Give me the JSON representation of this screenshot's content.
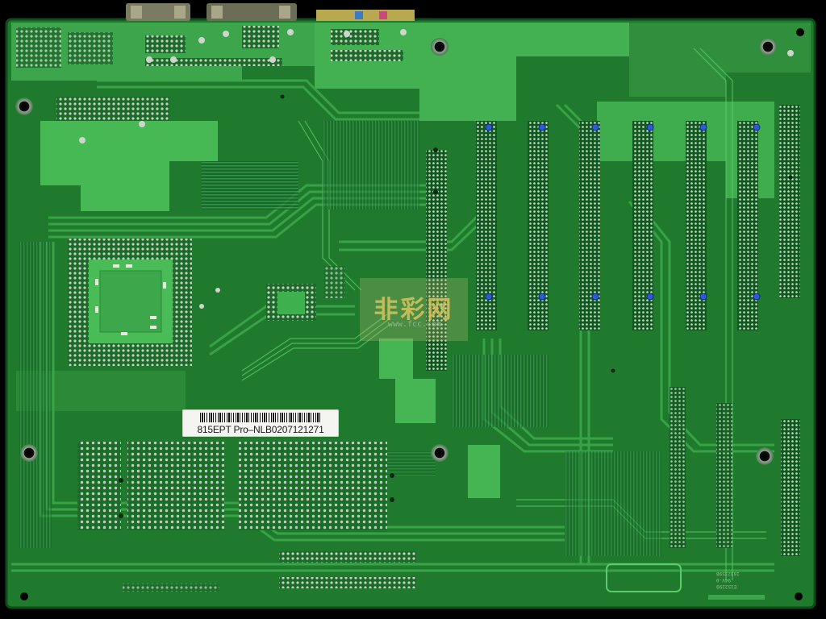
{
  "image": {
    "subject": "motherboard-pcb-rear-side",
    "colors": {
      "background": "#000000",
      "board": "#1f7a2e",
      "board_dark": "#0d4f1a",
      "trace": "#3aa848",
      "copper_fill": "#45b853",
      "solder": "#c9cfc6",
      "via": "#111111",
      "blue_component": "#2050c8"
    }
  },
  "label": {
    "text": "815EPT Pro–NLB0207121271"
  },
  "watermark": {
    "text_cn": "非彩网",
    "url": "www.fcc.com"
  },
  "silkscreen": {
    "bottom_right_code": "16323598",
    "bottom_right_line2": "94V-0",
    "bottom_right_line3": "E152299"
  }
}
